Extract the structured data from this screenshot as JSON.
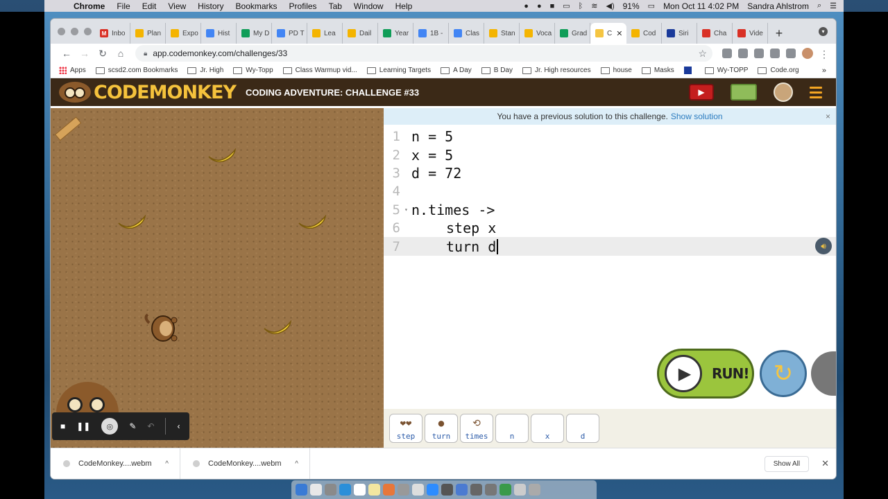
{
  "menubar": {
    "app": "Chrome",
    "items": [
      "File",
      "Edit",
      "View",
      "History",
      "Bookmarks",
      "Profiles",
      "Tab",
      "Window",
      "Help"
    ],
    "battery": "91%",
    "datetime": "Mon Oct 11  4:02 PM",
    "user": "Sandra Ahlstrom"
  },
  "tabs": [
    {
      "label": "Inbo",
      "color": "#d93025",
      "glyph": "M"
    },
    {
      "label": "Plan",
      "color": "#f4b400",
      "glyph": ""
    },
    {
      "label": "Expo",
      "color": "#f4b400",
      "glyph": ""
    },
    {
      "label": "Hist",
      "color": "#4285f4",
      "glyph": ""
    },
    {
      "label": "My D",
      "color": "#0f9d58",
      "glyph": ""
    },
    {
      "label": "PD T",
      "color": "#4285f4",
      "glyph": ""
    },
    {
      "label": "Lea",
      "color": "#f4b400",
      "glyph": ""
    },
    {
      "label": "Dail",
      "color": "#f4b400",
      "glyph": ""
    },
    {
      "label": "Year",
      "color": "#0f9d58",
      "glyph": ""
    },
    {
      "label": "1B -",
      "color": "#4285f4",
      "glyph": ""
    },
    {
      "label": "Clas",
      "color": "#4285f4",
      "glyph": ""
    },
    {
      "label": "Stan",
      "color": "#f4b400",
      "glyph": ""
    },
    {
      "label": "Voca",
      "color": "#f4b400",
      "glyph": ""
    },
    {
      "label": "Grad",
      "color": "#0f9d58",
      "glyph": ""
    },
    {
      "label": "C",
      "color": "#f5c542",
      "glyph": "",
      "active": true
    },
    {
      "label": "Cod",
      "color": "#f4b400",
      "glyph": ""
    },
    {
      "label": "Siri",
      "color": "#1a3a9a",
      "glyph": ""
    },
    {
      "label": "Cha",
      "color": "#d93025",
      "glyph": ""
    },
    {
      "label": "Vide",
      "color": "#d93025",
      "glyph": ""
    }
  ],
  "url": "app.codemonkey.com/challenges/33",
  "bookmarks": [
    {
      "label": "Apps",
      "type": "grid"
    },
    {
      "label": "scsd2.com Bookmarks",
      "type": "folder"
    },
    {
      "label": "Jr. High",
      "type": "folder"
    },
    {
      "label": "Wy-Topp",
      "type": "folder"
    },
    {
      "label": "Class Warmup vid...",
      "type": "folder"
    },
    {
      "label": "Learning Targets",
      "type": "folder"
    },
    {
      "label": "A Day",
      "type": "folder"
    },
    {
      "label": "B Day",
      "type": "folder"
    },
    {
      "label": "Jr. High resources",
      "type": "folder"
    },
    {
      "label": "house",
      "type": "folder"
    },
    {
      "label": "Masks",
      "type": "folder"
    },
    {
      "label": "",
      "type": "square"
    },
    {
      "label": "Wy-TOPP",
      "type": "folder"
    },
    {
      "label": "Code.org",
      "type": "folder"
    }
  ],
  "bookmarks_more": "»",
  "header": {
    "logo": "CODEMONKEY",
    "title": "CODING ADVENTURE: CHALLENGE #33"
  },
  "notice": {
    "text": "You have a previous solution to this challenge.",
    "link": "Show solution",
    "close": "×"
  },
  "code_lines": [
    {
      "n": "1",
      "text": "n = 5"
    },
    {
      "n": "2",
      "text": "x = 5"
    },
    {
      "n": "3",
      "text": "d = 72"
    },
    {
      "n": "4",
      "text": ""
    },
    {
      "n": "5",
      "text": "n.times ->"
    },
    {
      "n": "6",
      "text": "step x"
    },
    {
      "n": "7",
      "text": "turn d"
    }
  ],
  "run_label": "RUN!",
  "palette": [
    {
      "label": "step",
      "icon": "footprints-icon"
    },
    {
      "label": "turn",
      "icon": "monkey-icon"
    },
    {
      "label": "times",
      "icon": "loop-icon"
    },
    {
      "label": "n",
      "icon": ""
    },
    {
      "label": "x",
      "icon": ""
    },
    {
      "label": "d",
      "icon": ""
    }
  ],
  "downloads": [
    {
      "name": "CodeMonkey....webm"
    },
    {
      "name": "CodeMonkey....webm"
    }
  ],
  "show_all": "Show All"
}
